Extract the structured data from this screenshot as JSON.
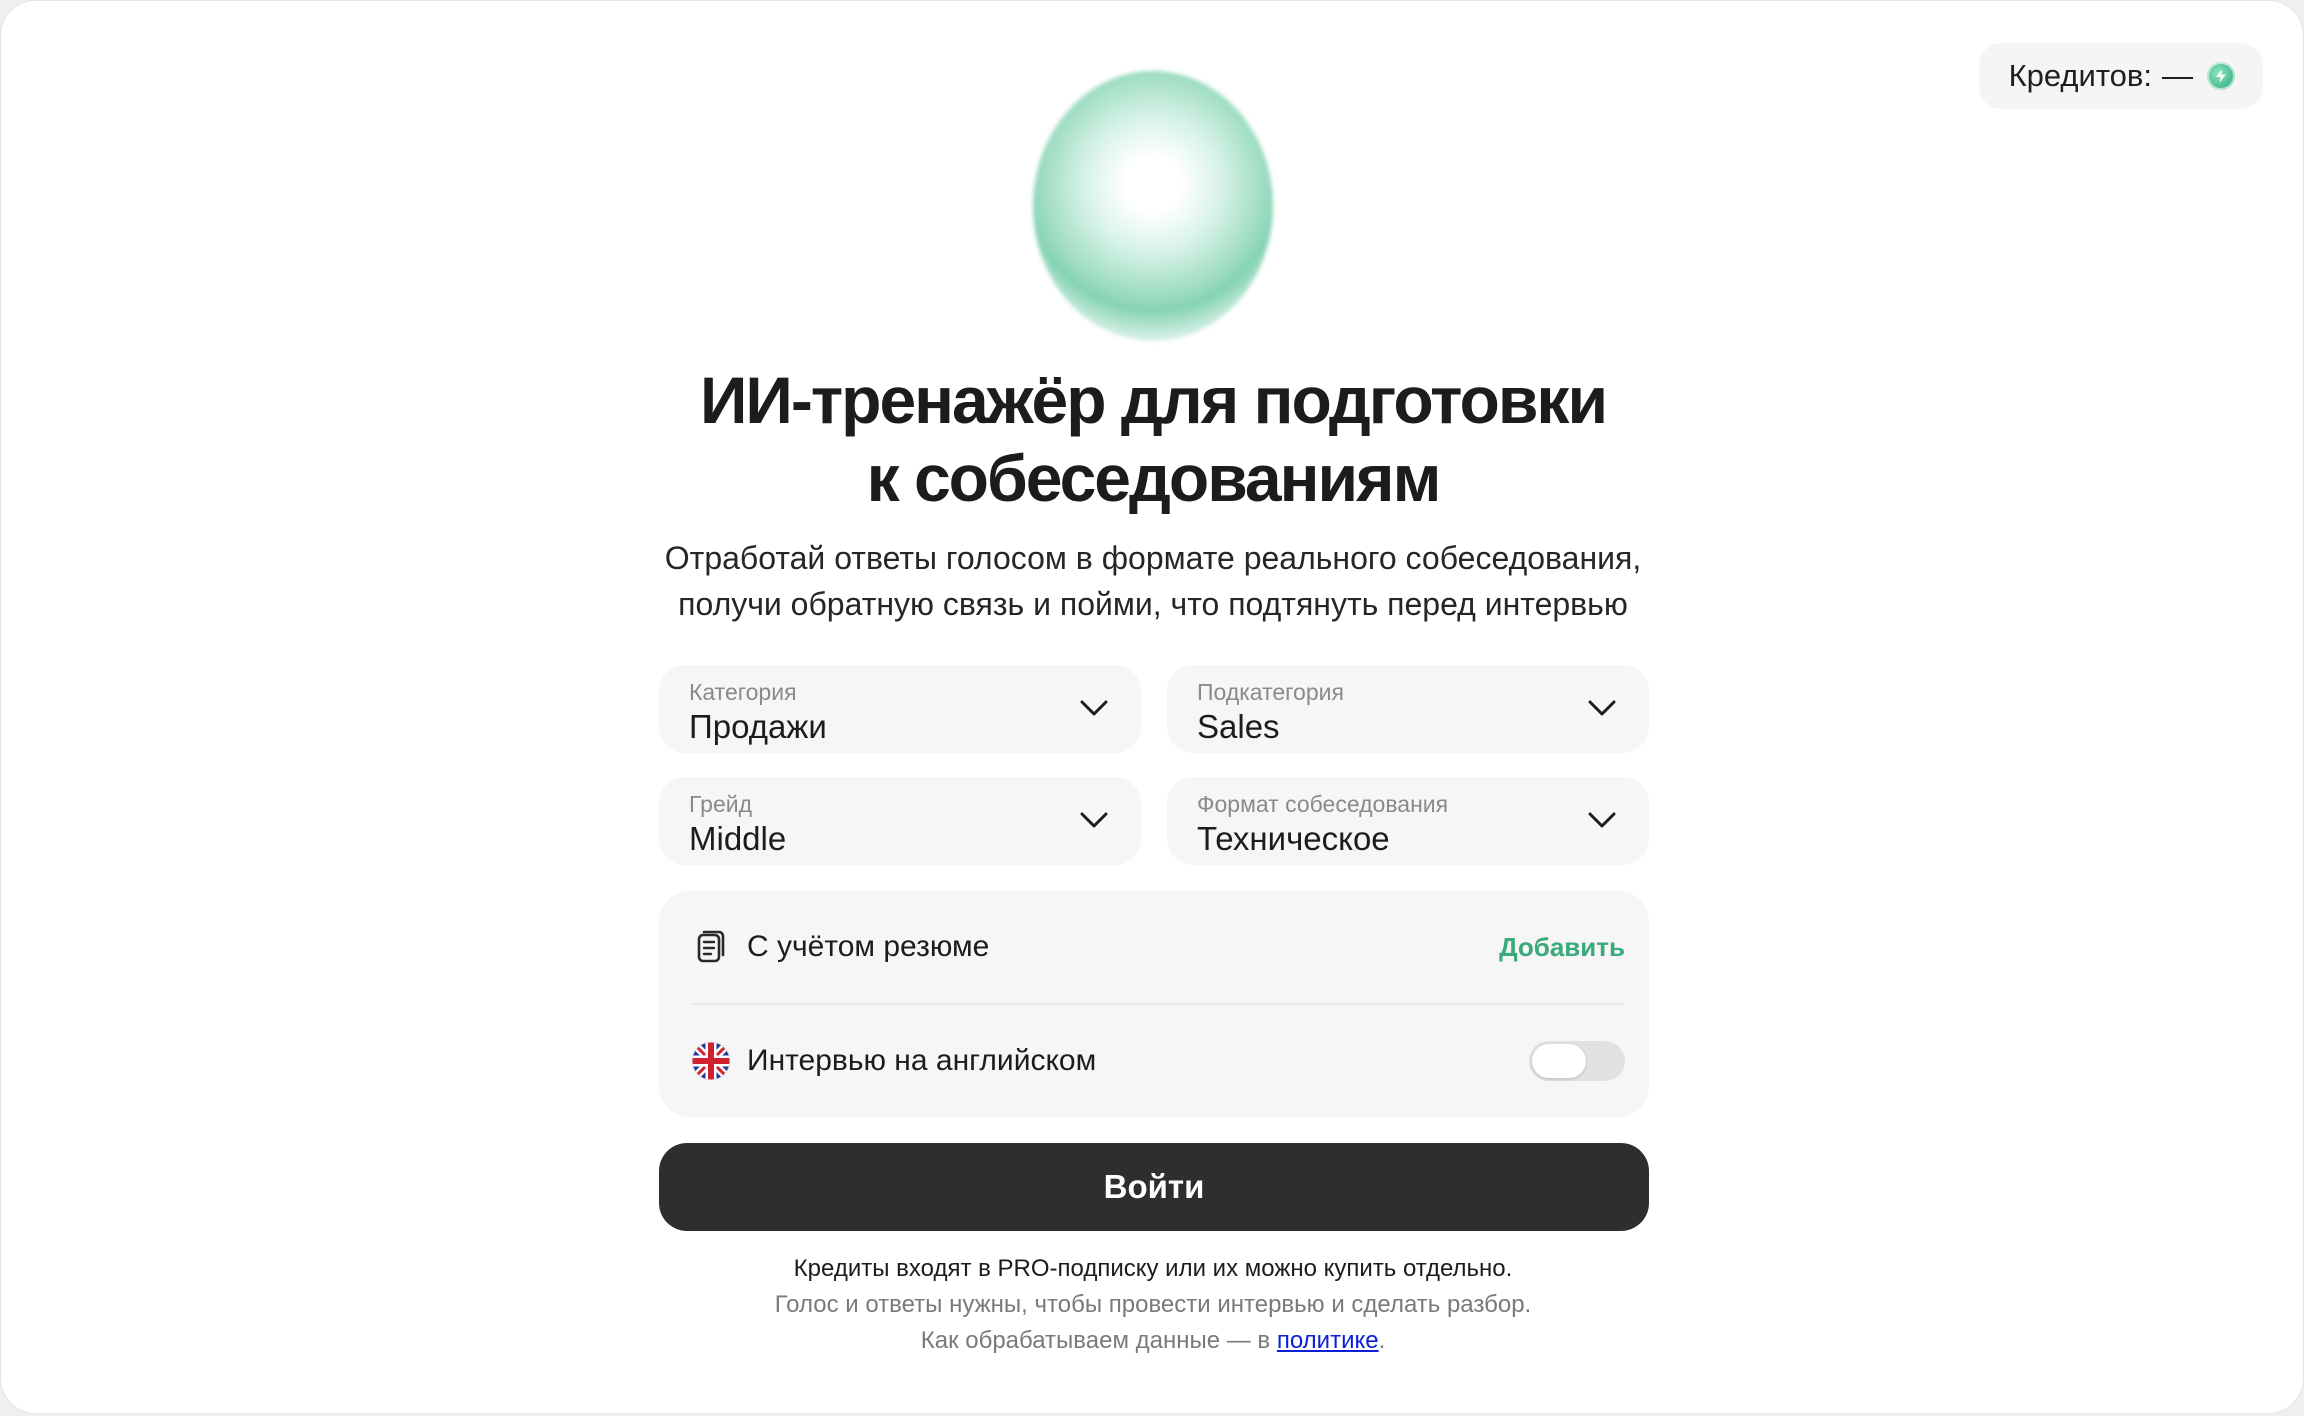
{
  "header": {
    "credits_label": "Кредитов:",
    "credits_value": "—",
    "credits_icon": "credit-coin-icon"
  },
  "hero": {
    "title_line1": "ИИ-тренажёр для подготовки",
    "title_line2": "к собеседованиям",
    "subtitle_line1": "Отработай ответы голосом в формате реального собеседования,",
    "subtitle_line2": "получи обратную связь и пойми, что подтянуть перед интервью"
  },
  "form": {
    "category": {
      "label": "Категория",
      "value": "Продажи"
    },
    "subcategory": {
      "label": "Подкатегория",
      "value": "Sales"
    },
    "grade": {
      "label": "Грейд",
      "value": "Middle"
    },
    "format": {
      "label": "Формат собеседования",
      "value": "Техническое"
    },
    "resume": {
      "label": "С учётом резюме",
      "action": "Добавить"
    },
    "english": {
      "label": "Интервью на английском",
      "enabled": false
    },
    "submit_label": "Войти"
  },
  "footer": {
    "line1": "Кредиты входят в PRO-подписку или их можно купить отдельно.",
    "line2": "Голос и ответы нужны, чтобы провести интервью и сделать разбор.",
    "line3_prefix": "Как обрабатываем данные — в ",
    "line3_link": "политике",
    "line3_suffix": "."
  },
  "colors": {
    "accent": "#3aa97c",
    "button": "#2e2e2e",
    "link": "#0a1fd6",
    "field_bg": "#f6f6f6"
  }
}
